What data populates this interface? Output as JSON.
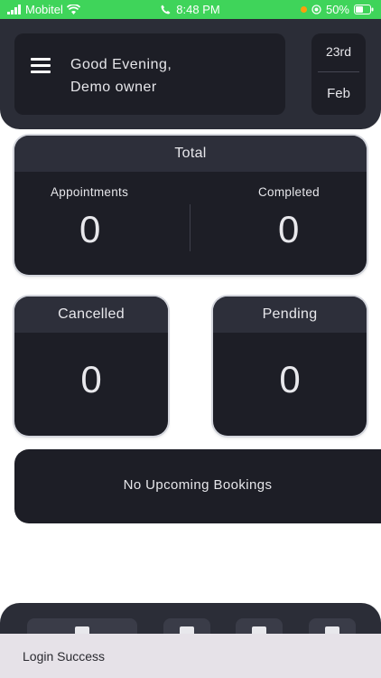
{
  "status_bar": {
    "carrier": "Mobitel",
    "time": "8:48 PM",
    "battery": "50%",
    "icons": [
      "signal-icon",
      "wifi-icon",
      "phone-icon",
      "location-icon",
      "battery-icon"
    ]
  },
  "header": {
    "greeting_line1": "Good Evening,",
    "greeting_line2": "Demo owner",
    "date_day": "23rd",
    "date_month": "Feb"
  },
  "total": {
    "title": "Total",
    "appointments_label": "Appointments",
    "appointments_value": "0",
    "completed_label": "Completed",
    "completed_value": "0"
  },
  "cancelled": {
    "title": "Cancelled",
    "value": "0"
  },
  "pending": {
    "title": "Pending",
    "value": "0"
  },
  "bookings": {
    "empty_text": "No Upcoming Bookings"
  },
  "snackbar": {
    "message": "Login Success"
  },
  "colors": {
    "status_bar": "#3fd45a",
    "header_bg": "#2b2d37",
    "card_bg": "#1d1e26",
    "card_head_bg": "#2d2f3a",
    "snackbar_bg": "#e6e2e8"
  }
}
